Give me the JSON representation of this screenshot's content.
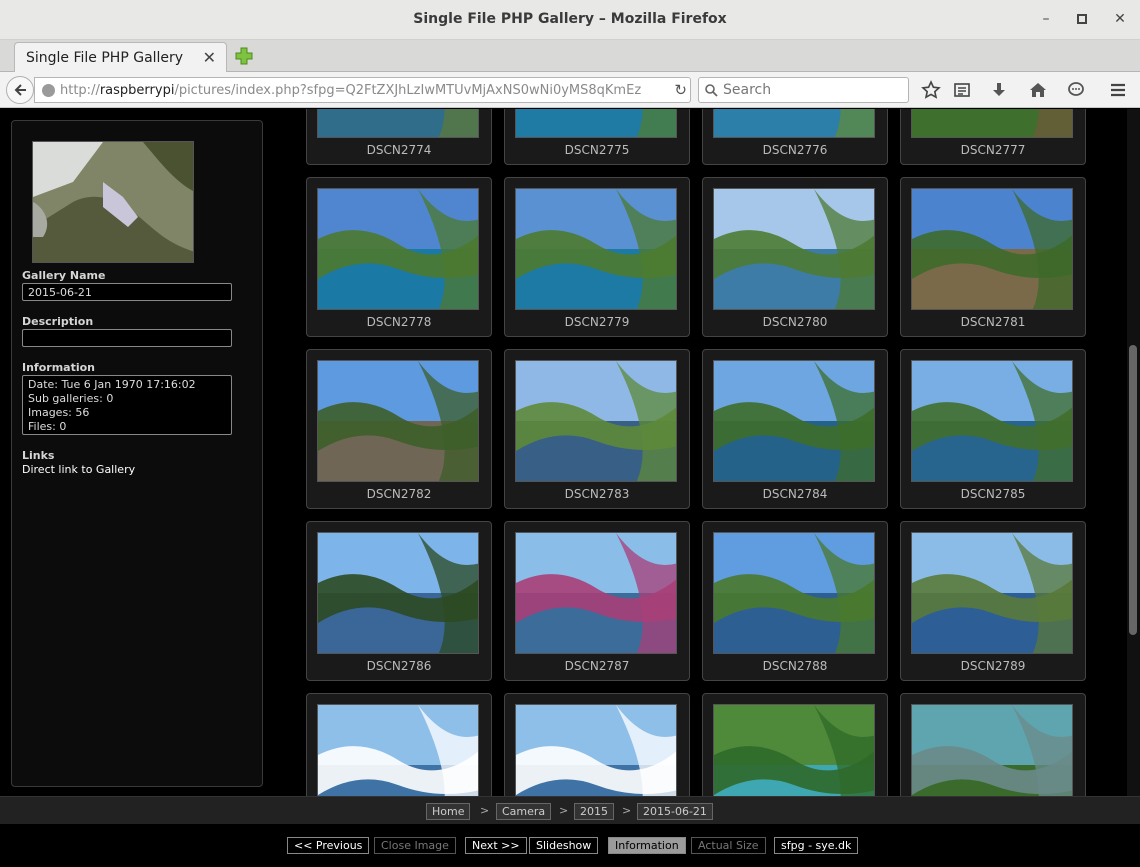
{
  "window": {
    "title": "Single File PHP Gallery – Mozilla Firefox"
  },
  "tab": {
    "label": "Single File PHP Gallery"
  },
  "address": {
    "prefix": "http://",
    "host": "raspberrypi",
    "path": "/pictures/index.php?sfpg=Q2FtZXJhLzIwMTUvMjAxNS0wNi0yMS8qKmEz"
  },
  "search": {
    "placeholder": "Search"
  },
  "sidebar": {
    "gallery_name_label": "Gallery Name",
    "gallery_name": "2015-06-21",
    "description_label": "Description",
    "description": "",
    "information_label": "Information",
    "info_lines": [
      "Date: Tue 6 Jan 1970 17:16:02",
      "Sub galleries: 0",
      "Images: 56",
      "Files: 0"
    ],
    "links_label": "Links",
    "link_text": "Direct link to Gallery"
  },
  "thumbnails": [
    "DSCN2774",
    "DSCN2775",
    "DSCN2776",
    "DSCN2777",
    "DSCN2778",
    "DSCN2779",
    "DSCN2780",
    "DSCN2781",
    "DSCN2782",
    "DSCN2783",
    "DSCN2784",
    "DSCN2785",
    "DSCN2786",
    "DSCN2787",
    "DSCN2788",
    "DSCN2789",
    "",
    "",
    "",
    ""
  ],
  "breadcrumb": [
    "Home",
    "Camera",
    "2015",
    "2015-06-21"
  ],
  "breadcrumb_sep": ">",
  "nav": {
    "previous": "<< Previous",
    "close_image": "Close Image",
    "next": "Next >>",
    "slideshow": "Slideshow",
    "information": "Information",
    "actual_size": "Actual Size",
    "credit": "sfpg - sye.dk"
  }
}
